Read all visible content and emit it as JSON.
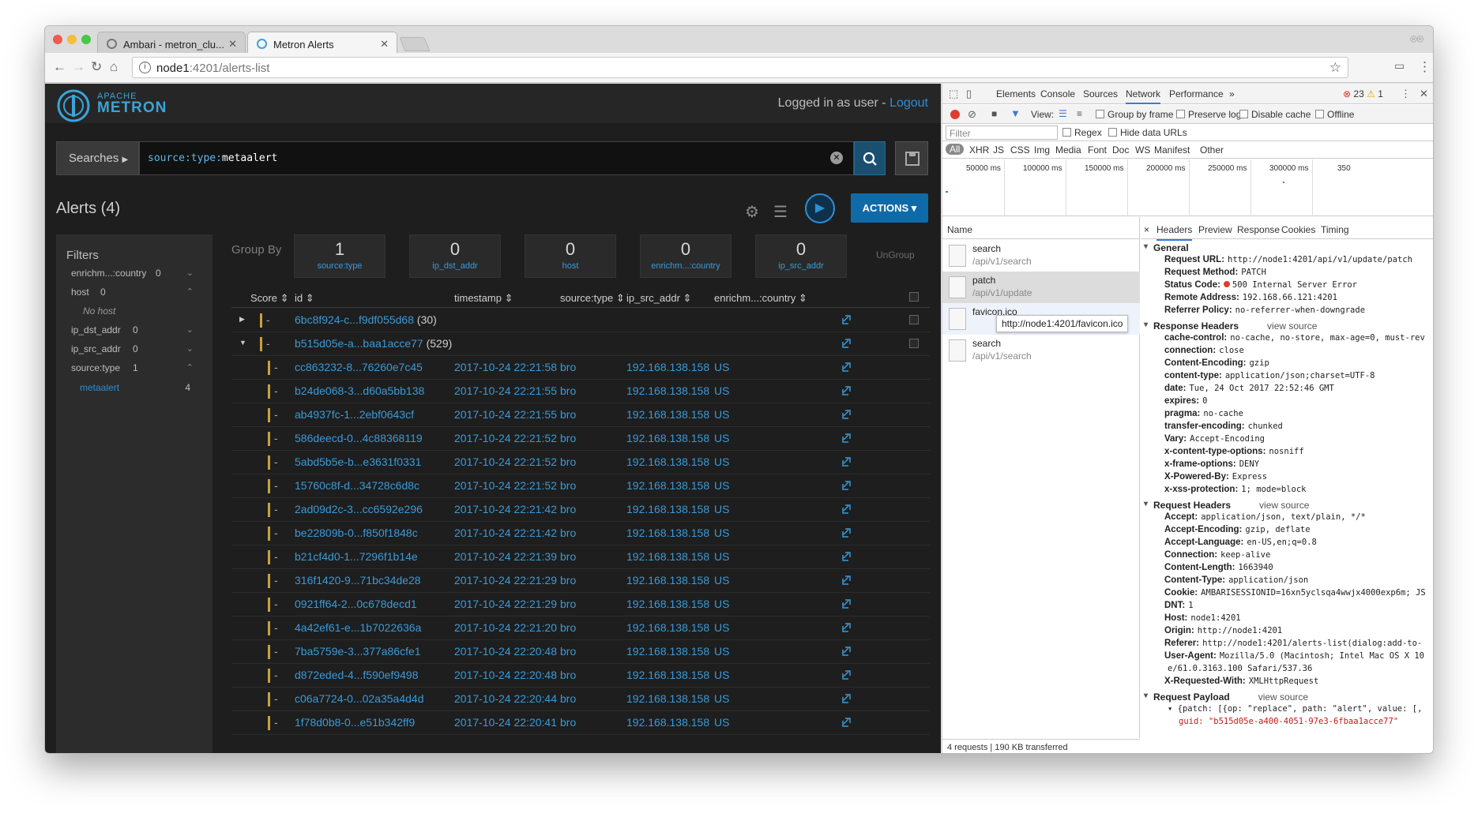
{
  "browser": {
    "tabs": [
      {
        "title": "Ambari - metron_clu...",
        "active": false
      },
      {
        "title": "Metron Alerts",
        "active": true
      }
    ],
    "url_host": "node1",
    "url_path": ":4201/alerts-list"
  },
  "app": {
    "logo_top": "APACHE",
    "logo_bottom": "METRON",
    "logged_in_text": "Logged in as user - ",
    "logout_label": "Logout",
    "searches_label": "Searches",
    "query_key": "source:type:",
    "query_value": "metaalert",
    "alerts_title": "Alerts (4)",
    "actions_label": "ACTIONS",
    "group_by_label": "Group By",
    "ungroup_label": "UnGroup",
    "group_cards": [
      {
        "count": "1",
        "label": "source:type"
      },
      {
        "count": "0",
        "label": "ip_dst_addr"
      },
      {
        "count": "0",
        "label": "host"
      },
      {
        "count": "0",
        "label": "enrichm...:country"
      },
      {
        "count": "0",
        "label": "ip_src_addr"
      }
    ],
    "filters": {
      "title": "Filters",
      "items": [
        {
          "label": "enrichm...:country",
          "count": "0",
          "arrow": "⌄"
        },
        {
          "label": "host",
          "count": "0",
          "arrow": "⌃"
        },
        {
          "label": "No host",
          "count": "",
          "arrow": ""
        },
        {
          "label": "ip_dst_addr",
          "count": "0",
          "arrow": "⌄"
        },
        {
          "label": "ip_src_addr",
          "count": "0",
          "arrow": "⌄"
        },
        {
          "label": "source:type",
          "count": "1",
          "arrow": "⌃"
        },
        {
          "label": "metaalert",
          "count": "4",
          "arrow": ""
        }
      ]
    },
    "columns": [
      "Score ⇕",
      "id ⇕",
      "timestamp ⇕",
      "source:type ⇕",
      "ip_src_addr ⇕",
      "enrichm...:country ⇕"
    ],
    "meta_rows": [
      {
        "toggle": "▶",
        "id": "6bc8f924-c...f9df055d68",
        "count": "(30)"
      },
      {
        "toggle": "▼",
        "id": "b515d05e-a...baa1acce77",
        "count": "(529)"
      }
    ],
    "alert_rows": [
      {
        "id": "cc863232-8...76260e7c45",
        "ts": "2017-10-24 22:21:58",
        "st": "bro",
        "ip": "192.168.138.158",
        "co": "US"
      },
      {
        "id": "b24de068-3...d60a5bb138",
        "ts": "2017-10-24 22:21:55",
        "st": "bro",
        "ip": "192.168.138.158",
        "co": "US"
      },
      {
        "id": "ab4937fc-1...2ebf0643cf",
        "ts": "2017-10-24 22:21:55",
        "st": "bro",
        "ip": "192.168.138.158",
        "co": "US"
      },
      {
        "id": "586deecd-0...4c88368119",
        "ts": "2017-10-24 22:21:52",
        "st": "bro",
        "ip": "192.168.138.158",
        "co": "US"
      },
      {
        "id": "5abd5b5e-b...e3631f0331",
        "ts": "2017-10-24 22:21:52",
        "st": "bro",
        "ip": "192.168.138.158",
        "co": "US"
      },
      {
        "id": "15760c8f-d...34728c6d8c",
        "ts": "2017-10-24 22:21:52",
        "st": "bro",
        "ip": "192.168.138.158",
        "co": "US"
      },
      {
        "id": "2ad09d2c-3...cc6592e296",
        "ts": "2017-10-24 22:21:42",
        "st": "bro",
        "ip": "192.168.138.158",
        "co": "US"
      },
      {
        "id": "be22809b-0...f850f1848c",
        "ts": "2017-10-24 22:21:42",
        "st": "bro",
        "ip": "192.168.138.158",
        "co": "US"
      },
      {
        "id": "b21cf4d0-1...7296f1b14e",
        "ts": "2017-10-24 22:21:39",
        "st": "bro",
        "ip": "192.168.138.158",
        "co": "US"
      },
      {
        "id": "316f1420-9...71bc34de28",
        "ts": "2017-10-24 22:21:29",
        "st": "bro",
        "ip": "192.168.138.158",
        "co": "US"
      },
      {
        "id": "0921ff64-2...0c678decd1",
        "ts": "2017-10-24 22:21:29",
        "st": "bro",
        "ip": "192.168.138.158",
        "co": "US"
      },
      {
        "id": "4a42ef61-e...1b7022636a",
        "ts": "2017-10-24 22:21:20",
        "st": "bro",
        "ip": "192.168.138.158",
        "co": "US"
      },
      {
        "id": "7ba5759e-3...377a86cfe1",
        "ts": "2017-10-24 22:20:48",
        "st": "bro",
        "ip": "192.168.138.158",
        "co": "US"
      },
      {
        "id": "d872eded-4...f590ef9498",
        "ts": "2017-10-24 22:20:48",
        "st": "bro",
        "ip": "192.168.138.158",
        "co": "US"
      },
      {
        "id": "c06a7724-0...02a35a4d4d",
        "ts": "2017-10-24 22:20:44",
        "st": "bro",
        "ip": "192.168.138.158",
        "co": "US"
      },
      {
        "id": "1f78d0b8-0...e51b342ff9",
        "ts": "2017-10-24 22:20:41",
        "st": "bro",
        "ip": "192.168.138.158",
        "co": "US"
      }
    ],
    "score_dash": "-"
  },
  "devtools": {
    "tabs": [
      "Elements",
      "Console",
      "Sources",
      "Network",
      "Performance",
      "»"
    ],
    "errors": "23",
    "warnings": "1",
    "view_label": "View:",
    "group_by_frame": "Group by frame",
    "preserve_log": "Preserve log",
    "disable_cache": "Disable cache",
    "offline": "Offline",
    "filter_placeholder": "Filter",
    "regex": "Regex",
    "hide_data_urls": "Hide data URLs",
    "types": [
      "All",
      "XHR",
      "JS",
      "CSS",
      "Img",
      "Media",
      "Font",
      "Doc",
      "WS",
      "Manifest",
      "Other"
    ],
    "timeline_labels": [
      "50000 ms",
      "100000 ms",
      "150000 ms",
      "200000 ms",
      "250000 ms",
      "300000 ms",
      "350"
    ],
    "name_header": "Name",
    "requests": [
      {
        "name": "search",
        "path": "/api/v1/search"
      },
      {
        "name": "patch",
        "path": "/api/v1/update"
      },
      {
        "name": "favicon.ico",
        "path": ""
      },
      {
        "name": "search",
        "path": "/api/v1/search"
      }
    ],
    "tooltip": "http://node1:4201/favicon.ico",
    "status": "4 requests | 190 KB transferred",
    "detail_tabs": [
      "×",
      "Headers",
      "Preview",
      "Response",
      "Cookies",
      "Timing"
    ],
    "view_source": "view source",
    "general": {
      "title": "General",
      "items": [
        {
          "k": "Request URL:",
          "v": "http://node1:4201/api/v1/update/patch"
        },
        {
          "k": "Request Method:",
          "v": "PATCH"
        },
        {
          "k": "Status Code:",
          "v": "500 Internal Server Error"
        },
        {
          "k": "Remote Address:",
          "v": "192.168.66.121:4201"
        },
        {
          "k": "Referrer Policy:",
          "v": "no-referrer-when-downgrade"
        }
      ]
    },
    "response_headers": {
      "title": "Response Headers",
      "items": [
        {
          "k": "cache-control:",
          "v": "no-cache, no-store, max-age=0, must-rev"
        },
        {
          "k": "connection:",
          "v": "close"
        },
        {
          "k": "Content-Encoding:",
          "v": "gzip"
        },
        {
          "k": "content-type:",
          "v": "application/json;charset=UTF-8"
        },
        {
          "k": "date:",
          "v": "Tue, 24 Oct 2017 22:52:46 GMT"
        },
        {
          "k": "expires:",
          "v": "0"
        },
        {
          "k": "pragma:",
          "v": "no-cache"
        },
        {
          "k": "transfer-encoding:",
          "v": "chunked"
        },
        {
          "k": "Vary:",
          "v": "Accept-Encoding"
        },
        {
          "k": "x-content-type-options:",
          "v": "nosniff"
        },
        {
          "k": "x-frame-options:",
          "v": "DENY"
        },
        {
          "k": "X-Powered-By:",
          "v": "Express"
        },
        {
          "k": "x-xss-protection:",
          "v": "1; mode=block"
        }
      ]
    },
    "request_headers": {
      "title": "Request Headers",
      "items": [
        {
          "k": "Accept:",
          "v": "application/json, text/plain, */*"
        },
        {
          "k": "Accept-Encoding:",
          "v": "gzip, deflate"
        },
        {
          "k": "Accept-Language:",
          "v": "en-US,en;q=0.8"
        },
        {
          "k": "Connection:",
          "v": "keep-alive"
        },
        {
          "k": "Content-Length:",
          "v": "1663940"
        },
        {
          "k": "Content-Type:",
          "v": "application/json"
        },
        {
          "k": "Cookie:",
          "v": "AMBARISESSIONID=16xn5yclsqa4wwjx4000exp6m; JS"
        },
        {
          "k": "DNT:",
          "v": "1"
        },
        {
          "k": "Host:",
          "v": "node1:4201"
        },
        {
          "k": "Origin:",
          "v": "http://node1:4201"
        },
        {
          "k": "Referer:",
          "v": "http://node1:4201/alerts-list(dialog:add-to-"
        },
        {
          "k": "User-Agent:",
          "v": "Mozilla/5.0 (Macintosh; Intel Mac OS X 10"
        },
        {
          "k": "",
          "v": "e/61.0.3163.100 Safari/537.36"
        },
        {
          "k": "X-Requested-With:",
          "v": "XMLHttpRequest"
        }
      ]
    },
    "payload": {
      "title": "Request Payload",
      "line1": "▾ {patch: [{op: \"replace\", path: \"alert\", value: [,",
      "line2": "guid: \"b515d05e-a400-4051-97e3-6fbaa1acce77\""
    }
  },
  "colors": {
    "accent": "#2b8fd6",
    "app_bg": "#1e1e1e",
    "score_bar": "#c8a23a"
  }
}
